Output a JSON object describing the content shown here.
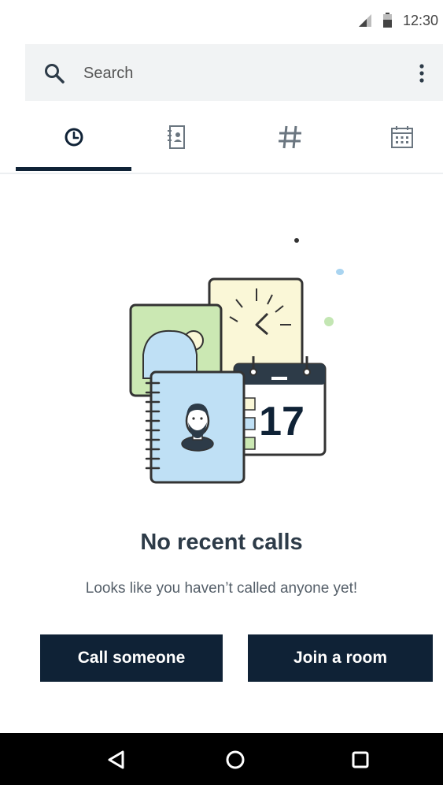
{
  "status_bar": {
    "time": "12:30",
    "signal_icon": "cell-signal-icon",
    "battery_icon": "battery-icon"
  },
  "search": {
    "placeholder": "Search",
    "icon": "search-icon",
    "menu_icon": "more-vert-icon"
  },
  "tabs": [
    {
      "id": "recents",
      "icon": "clock-icon",
      "selected": true
    },
    {
      "id": "contacts",
      "icon": "contacts-book-icon",
      "selected": false
    },
    {
      "id": "dialpad",
      "icon": "hash-icon",
      "selected": false
    },
    {
      "id": "calendar",
      "icon": "calendar-icon",
      "selected": false
    }
  ],
  "empty_state": {
    "title": "No recent calls",
    "subtitle": "Looks like you haven’t called anyone yet!",
    "illustration_day": "17"
  },
  "actions": {
    "call_label": "Call someone",
    "join_label": "Join a room"
  },
  "nav_bar": {
    "back_icon": "back-triangle-icon",
    "home_icon": "home-circle-icon",
    "recents_icon": "overview-square-icon"
  },
  "colors": {
    "primary": "#0f2236",
    "search_bg": "#f1f3f4",
    "title": "#2d3b48",
    "subtitle": "#555f69"
  }
}
